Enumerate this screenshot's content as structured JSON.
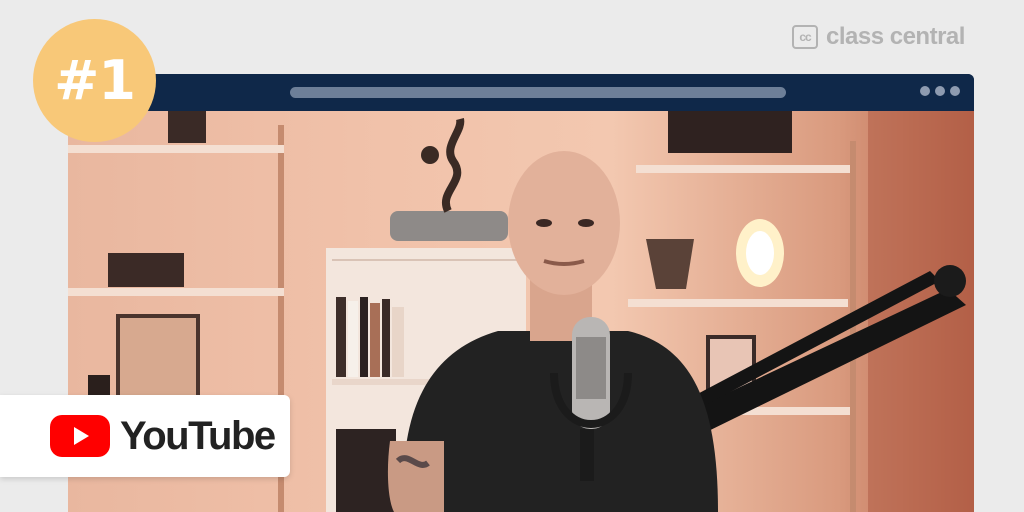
{
  "brand": {
    "name": "class central",
    "icon_text": "cc"
  },
  "badge": {
    "rank": "#1"
  },
  "platform": {
    "name": "YouTube",
    "icon": "youtube-play-icon"
  },
  "window": {
    "menu_icon": "more-dots-icon"
  },
  "colors": {
    "window_bar": "#0f2849",
    "badge": "#f8c878",
    "youtube_red": "#ff0000"
  }
}
